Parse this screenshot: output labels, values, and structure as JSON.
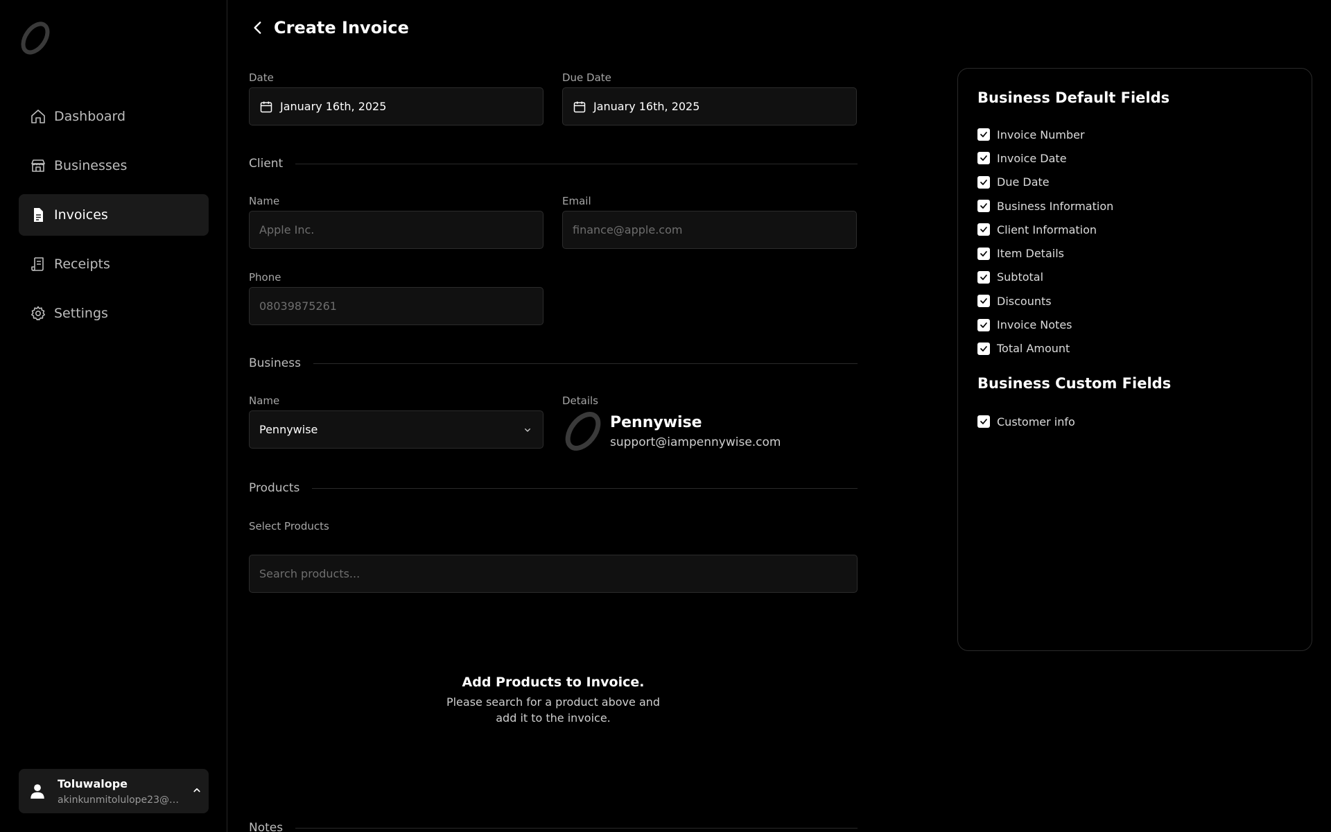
{
  "sidebar": {
    "nav": [
      {
        "label": "Dashboard",
        "icon": "home-icon"
      },
      {
        "label": "Businesses",
        "icon": "store-icon"
      },
      {
        "label": "Invoices",
        "icon": "file-icon",
        "active": true
      },
      {
        "label": "Receipts",
        "icon": "receipt-icon"
      },
      {
        "label": "Settings",
        "icon": "gear-icon"
      }
    ],
    "user": {
      "name": "Toluwalope",
      "email": "akinkunmitolulope23@g..."
    }
  },
  "header": {
    "title": "Create Invoice"
  },
  "form": {
    "date": {
      "label": "Date",
      "value": "January 16th, 2025"
    },
    "due_date": {
      "label": "Due Date",
      "value": "January 16th, 2025"
    },
    "client": {
      "section": "Client",
      "name": {
        "label": "Name",
        "placeholder": "Apple Inc."
      },
      "email": {
        "label": "Email",
        "placeholder": "finance@apple.com"
      },
      "phone": {
        "label": "Phone",
        "placeholder": "08039875261"
      }
    },
    "business": {
      "section": "Business",
      "name_label": "Name",
      "name_value": "Pennywise",
      "details_label": "Details",
      "details_name": "Pennywise",
      "details_email": "support@iampennywise.com"
    },
    "products": {
      "section": "Products",
      "select_label": "Select Products",
      "search_placeholder": "Search products...",
      "empty_title": "Add Products to Invoice.",
      "empty_desc": "Please search for a product above and add it to the invoice."
    },
    "notes": {
      "section": "Notes"
    }
  },
  "panel": {
    "default_title": "Business Default Fields",
    "default_fields": [
      "Invoice Number",
      "Invoice Date",
      "Due Date",
      "Business Information",
      "Client Information",
      "Item Details",
      "Subtotal",
      "Discounts",
      "Invoice Notes",
      "Total Amount"
    ],
    "custom_title": "Business Custom Fields",
    "custom_fields": [
      "Customer info"
    ]
  },
  "colors": {
    "background": "#000000",
    "surface": "#111111",
    "border": "#2c2c2c",
    "text": "#ffffff",
    "muted": "#a6a6a6"
  }
}
